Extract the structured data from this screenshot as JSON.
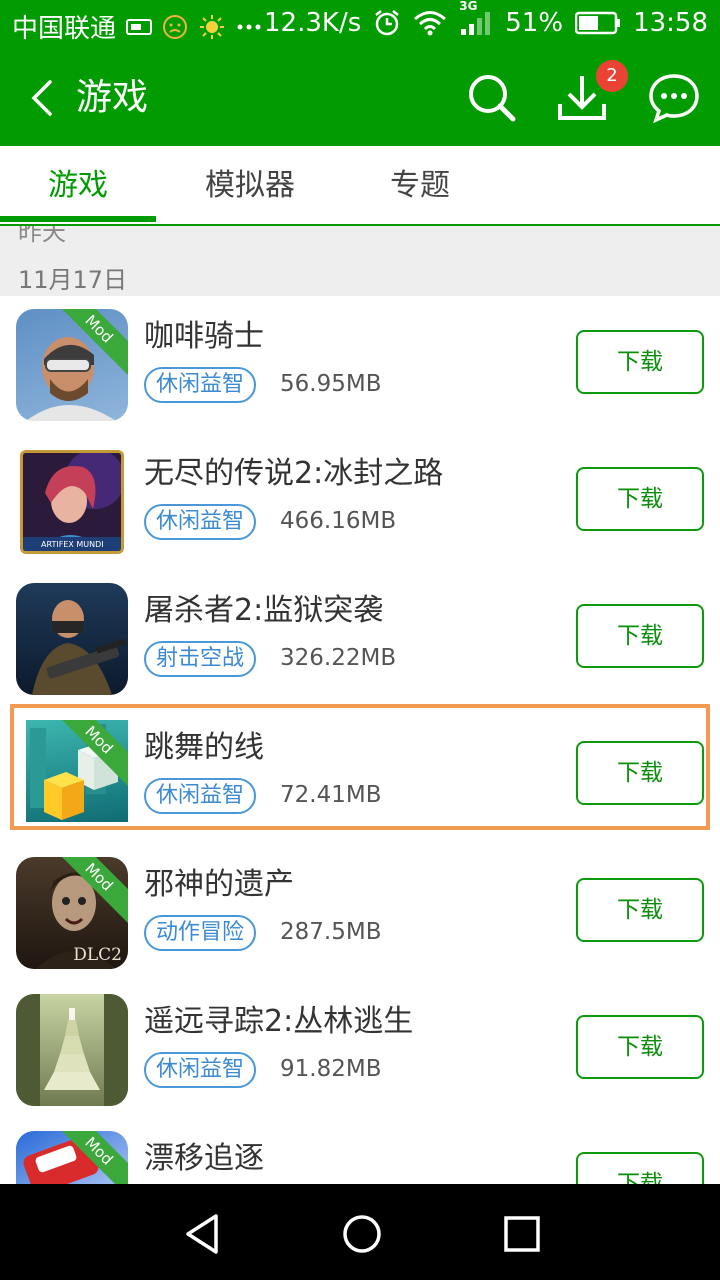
{
  "status_bar": {
    "carrier": "中国联通",
    "speed": "12.3K/s",
    "network": "3G",
    "battery": "51%",
    "time": "13:58"
  },
  "app_bar": {
    "title": "游戏",
    "download_badge": "2"
  },
  "tabs": [
    {
      "label": "游戏",
      "active": true
    },
    {
      "label": "模拟器",
      "active": false
    },
    {
      "label": "专题",
      "active": false
    }
  ],
  "section": {
    "previous_label": "昨天",
    "date": "11月17日"
  },
  "download_label": "下载",
  "games": [
    {
      "name": "咖啡骑士",
      "tag": "休闲益智",
      "size": "56.95MB",
      "mod": "Mod"
    },
    {
      "name": "无尽的传说2:冰封之路",
      "tag": "休闲益智",
      "size": "466.16MB",
      "mod": ""
    },
    {
      "name": "屠杀者2:监狱突袭",
      "tag": "射击空战",
      "size": "326.22MB",
      "mod": ""
    },
    {
      "name": "跳舞的线",
      "tag": "休闲益智",
      "size": "72.41MB",
      "mod": "Mod"
    },
    {
      "name": "邪神的遗产",
      "tag": "动作冒险",
      "size": "287.5MB",
      "mod": "Mod"
    },
    {
      "name": "遥远寻踪2:丛林逃生",
      "tag": "休闲益智",
      "size": "91.82MB",
      "mod": ""
    },
    {
      "name": "漂移追逐",
      "tag": "",
      "size": "",
      "mod": "Mod"
    }
  ],
  "icon_labels": {
    "game2": "ARTIFEX MUNDI",
    "game5": "DLC2"
  }
}
